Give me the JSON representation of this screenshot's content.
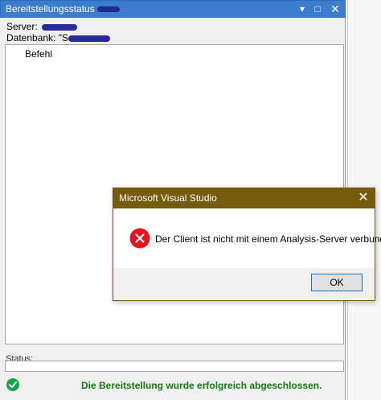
{
  "deploy_window": {
    "title": "Bereitstellungsstatus",
    "buttons": {
      "minimize": "▾",
      "maximize": "□",
      "close": "✕"
    },
    "server_label": "Server:",
    "server_value_prefix": "",
    "database_label": "Datenbank:",
    "database_value_prefix": "\"S",
    "list_column_header": "Befehl",
    "status_label": "Status:",
    "result_message": "Die Bereitstellung wurde erfolgreich abgeschlossen.",
    "result_icon": "success-check-icon"
  },
  "dialog": {
    "title": "Microsoft Visual Studio",
    "close_glyph": "✕",
    "message": "Der Client ist nicht mit einem Analysis-Server verbunden.",
    "icon": "error-icon",
    "ok_label": "OK"
  },
  "colors": {
    "deploy_titlebar": "#3b7ccd",
    "dialog_titlebar": "#755c0d",
    "success_text": "#107c10",
    "error_icon": "#e81123"
  }
}
